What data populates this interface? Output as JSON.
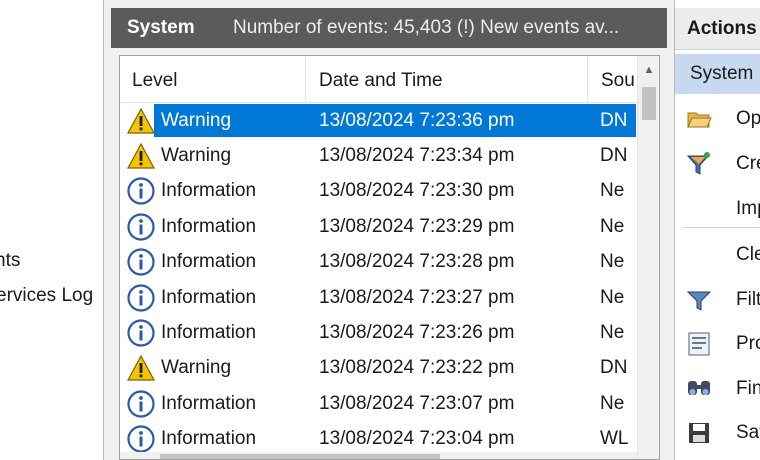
{
  "nav": {
    "items": [
      {
        "label": "nts"
      },
      {
        "label": "ervices Log"
      }
    ]
  },
  "center": {
    "title": "System",
    "subtitle": "Number of events: 45,403 (!) New events av...",
    "columns": {
      "level": "Level",
      "date": "Date and Time",
      "source": "Sou"
    },
    "rows": [
      {
        "icon": "warning",
        "level": "Warning",
        "date": "13/08/2024 7:23:36 pm",
        "source": "DN",
        "selected": true
      },
      {
        "icon": "warning",
        "level": "Warning",
        "date": "13/08/2024 7:23:34 pm",
        "source": "DN"
      },
      {
        "icon": "info",
        "level": "Information",
        "date": "13/08/2024 7:23:30 pm",
        "source": "Ne"
      },
      {
        "icon": "info",
        "level": "Information",
        "date": "13/08/2024 7:23:29 pm",
        "source": "Ne"
      },
      {
        "icon": "info",
        "level": "Information",
        "date": "13/08/2024 7:23:28 pm",
        "source": "Ne"
      },
      {
        "icon": "info",
        "level": "Information",
        "date": "13/08/2024 7:23:27 pm",
        "source": "Ne"
      },
      {
        "icon": "info",
        "level": "Information",
        "date": "13/08/2024 7:23:26 pm",
        "source": "Ne"
      },
      {
        "icon": "warning",
        "level": "Warning",
        "date": "13/08/2024 7:23:22 pm",
        "source": "DN"
      },
      {
        "icon": "info",
        "level": "Information",
        "date": "13/08/2024 7:23:07 pm",
        "source": "Ne"
      },
      {
        "icon": "info",
        "level": "Information",
        "date": "13/08/2024 7:23:04 pm",
        "source": "WL"
      }
    ]
  },
  "actions": {
    "header": "Actions",
    "sub": "System",
    "items": [
      {
        "icon": "open-folder-icon",
        "label": "Op"
      },
      {
        "icon": "create-filter-icon",
        "label": "Cre"
      },
      {
        "icon": "",
        "label": "Imp"
      },
      {
        "icon": "",
        "label": "Cle"
      },
      {
        "icon": "filter-icon",
        "label": "Filt"
      },
      {
        "icon": "properties-icon",
        "label": "Pro"
      },
      {
        "icon": "find-icon",
        "label": "Fin"
      },
      {
        "icon": "save-icon",
        "label": "Sav"
      }
    ]
  },
  "colors": {
    "selection": "#0078d7",
    "header_bar": "#5b5b5b",
    "actions_sub_bg": "#c7d9ef",
    "warning_yellow": "#f5c400",
    "info_blue": "#2c5aa8"
  }
}
